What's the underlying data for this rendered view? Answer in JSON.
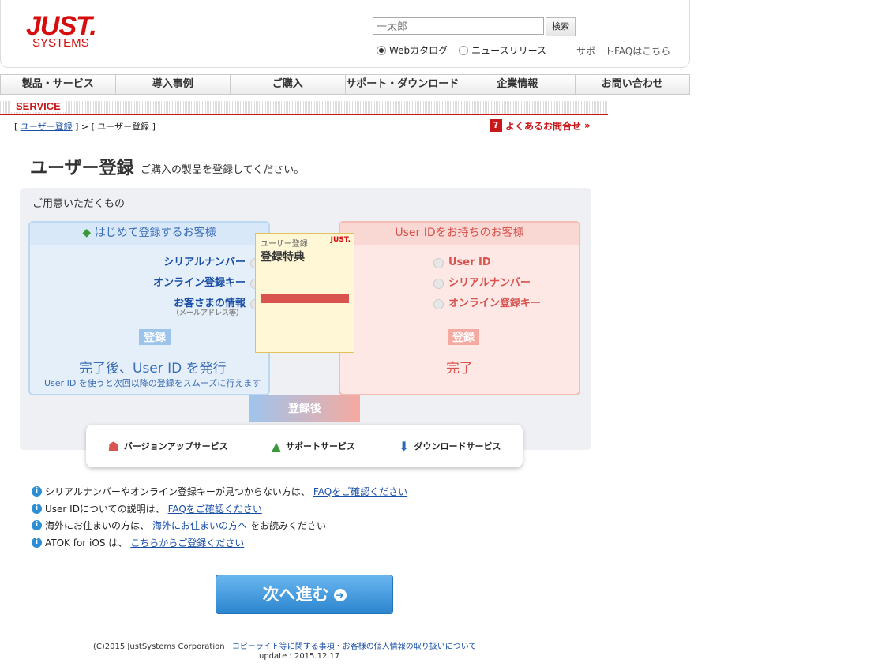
{
  "header": {
    "logo_main": "JUST.",
    "logo_sub": "SYSTEMS",
    "search_placeholder": "一太郎",
    "search_button": "検索",
    "radio_web": "Webカタログ",
    "radio_news": "ニュースリリース",
    "support_faq": "サポートFAQはこちら"
  },
  "nav": [
    "製品・サービス",
    "導入事例",
    "ご購入",
    "サポート・ダウンロード",
    "企業情報",
    "お問い合わせ"
  ],
  "service_label": "SERVICE",
  "breadcrumb": {
    "link": "ユーザー登録",
    "current": "[ ユーザー登録 ]",
    "open": "[",
    "close": "] >"
  },
  "faq_qa": "よくあるお問合せ",
  "page": {
    "title": "ユーザー登録",
    "subtitle": "ご購入の製品を登録してください。"
  },
  "diagram": {
    "prep": "ご用意いただくもの",
    "left_head": "はじめて登録するお客様",
    "left_items": [
      "シリアルナンバー",
      "オンライン登録キー",
      "お客さまの情報"
    ],
    "left_note": "（メールアドレス等）",
    "left_reg": "登録",
    "left_done": "完了後、User ID を発行",
    "left_done_sub": "User ID を使うと次回以降の登録をスムーズに行えます",
    "right_head": "User IDをお持ちのお客様",
    "right_items": [
      "User ID",
      "シリアルナンバー",
      "オンライン登録キー"
    ],
    "right_reg": "登録",
    "right_done": "完了",
    "benefit_head": "ユーザー登録",
    "benefit_title": "登録特典",
    "benefit_logo": "JUST.",
    "after": "登録後"
  },
  "services": [
    "バージョンアップサービス",
    "サポートサービス",
    "ダウンロードサービス"
  ],
  "info": [
    {
      "text": "シリアルナンバーやオンライン登録キーが見つからない方は、",
      "link": "FAQをご確認ください",
      "after": ""
    },
    {
      "text": "User IDについての説明は、",
      "link": "FAQをご確認ください",
      "after": ""
    },
    {
      "text": "海外にお住まいの方は、",
      "link": "海外にお住まいの方へ",
      "after": "をお読みください"
    },
    {
      "text": "ATOK for iOS は、",
      "link": "こちらからご登録ください",
      "after": ""
    }
  ],
  "next_button": "次へ進む",
  "footer": {
    "copyright": "(C)2015 JustSystems Corporation",
    "link1": "コピーライト等に関する事項",
    "sep": "・",
    "link2": "お客様の個人情報の取り扱いについて",
    "update": "update : 2015.12.17"
  },
  "colors": {
    "brand": "#d60d0d",
    "link": "#1a4fa8",
    "button": "#2c85cf"
  }
}
